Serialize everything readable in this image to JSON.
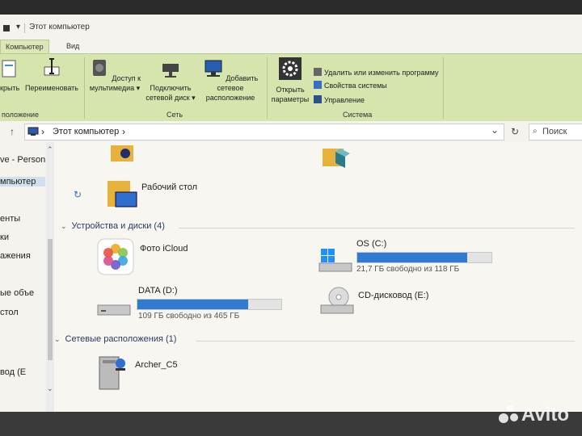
{
  "window": {
    "title": "Этот компьютер",
    "title_prefix": "▾"
  },
  "ribbon": {
    "tabs": [
      {
        "label": "Компьютер",
        "active": true
      },
      {
        "label": "Вид",
        "active": false
      }
    ],
    "buttons": {
      "open": "крыть",
      "rename": "Переименовать",
      "media_line1": "Доступ к",
      "media_line2": "мультимедиа ▾",
      "netdisk_line1": "Подключить",
      "netdisk_line2": "сетевой диск ▾",
      "netloc_line1": "Добавить сетевое",
      "netloc_line2": "расположение",
      "settings_line1": "Открыть",
      "settings_line2": "параметры"
    },
    "groups": {
      "location": "положение",
      "network": "Сеть",
      "system": "Система"
    },
    "system_items": [
      "Удалить или изменить программу",
      "Свойства системы",
      "Управление"
    ]
  },
  "address": {
    "back": "↑",
    "path_arrow": "›",
    "path": "Этот компьютер",
    "path_arrow2": "›",
    "dropdown": "⌄",
    "refresh": "↻",
    "search_placeholder": "Поиск"
  },
  "nav": {
    "items": [
      "ve - Person",
      "мпьютер",
      "енты",
      "ки",
      "ажения",
      "ые объе",
      "стол",
      "вод (E",
      "вод (E"
    ],
    "scroll_down": "⌄"
  },
  "main": {
    "partial_label_1": "",
    "desktop_label": "Рабочий стол",
    "devices_header": "Устройства и диски (4)",
    "devices": {
      "icloud": {
        "label": "Фото iCloud"
      },
      "osc": {
        "label": "OS (C:)",
        "free_text": "21,7 ГБ свободно из 118 ГБ",
        "used_fraction": 0.82
      },
      "datad": {
        "label": "DATA (D:)",
        "free_text": "109 ГБ свободно из 465 ГБ",
        "used_fraction": 0.77
      },
      "cde": {
        "label": "CD-дисковод (E:)"
      }
    },
    "network_header": "Сетевые расположения (1)",
    "network": {
      "archer": {
        "label": "Archer_C5"
      }
    }
  },
  "watermark": {
    "text": "Avito"
  },
  "colors": {
    "ribbon": "#d6e4ae",
    "bar_fill": "#2f7bd1",
    "header_text": "#2a3a66"
  }
}
